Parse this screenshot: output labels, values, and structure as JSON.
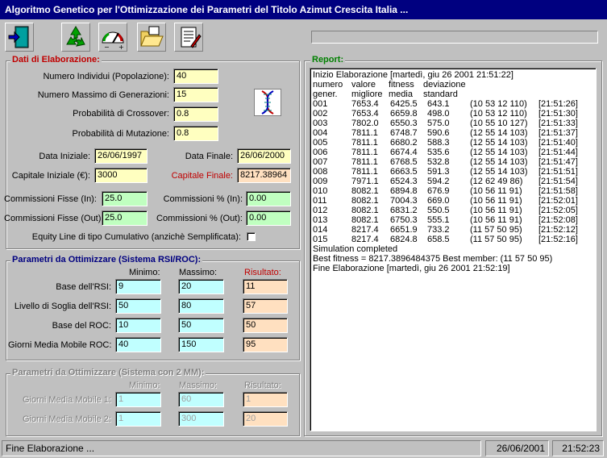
{
  "window": {
    "title": "Algoritmo Genetico per l'Ottimizzazione dei Parametri del Titolo Azimut Crescita Italia ..."
  },
  "toolbar": {
    "icons": [
      "exit-door-icon",
      "recycle-icon",
      "gauge-icon",
      "folder-open-icon",
      "notes-icon"
    ]
  },
  "elaborazione": {
    "title": "Dati di Elaborazione:",
    "individui_label": "Numero Individui (Popolazione):",
    "individui_value": "40",
    "generazioni_label": "Numero Massimo di Generazioni:",
    "generazioni_value": "15",
    "crossover_label": "Probabilità di Crossover:",
    "crossover_value": "0.8",
    "mutazione_label": "Probabilità di Mutazione:",
    "mutazione_value": "0.8",
    "dna_icon": "dna-icon",
    "data_iniziale_label": "Data Iniziale:",
    "data_iniziale_value": "26/06/1997",
    "data_finale_label": "Data Finale:",
    "data_finale_value": "26/06/2000",
    "capitale_iniziale_label": "Capitale Iniziale (€):",
    "capitale_iniziale_value": "3000",
    "capitale_finale_label": "Capitale Finale:",
    "capitale_finale_value": "8217.38964",
    "comm_fisse_in_label": "Commissioni Fisse (In):",
    "comm_fisse_in_value": "25.0",
    "comm_perc_in_label": "Commissioni % (In):",
    "comm_perc_in_value": "0.00",
    "comm_fisse_out_label": "Commissioni Fisse (Out):",
    "comm_fisse_out_value": "25.0",
    "comm_perc_out_label": "Commissioni % (Out):",
    "comm_perc_out_value": "0.00",
    "equity_label": "Equity Line di tipo Cumulativo (anzichè Semplificata):",
    "equity_checked": false
  },
  "rsi": {
    "title": "Parametri da Ottimizzare (Sistema RSI/ROC):",
    "col_min": "Minimo:",
    "col_max": "Massimo:",
    "col_res": "Risultato:",
    "rows": [
      {
        "label": "Base dell'RSI:",
        "min": "9",
        "max": "20",
        "res": "11"
      },
      {
        "label": "Livello di Soglia dell'RSI:",
        "min": "50",
        "max": "80",
        "res": "57"
      },
      {
        "label": "Base del ROC:",
        "min": "10",
        "max": "50",
        "res": "50"
      },
      {
        "label": "Giorni Media Mobile ROC:",
        "min": "40",
        "max": "150",
        "res": "95"
      }
    ]
  },
  "mm": {
    "title": "Parametri da Ottimizzare (Sistema con 2 MM):",
    "col_min": "Minimo:",
    "col_max": "Massimo:",
    "col_res": "Risultato:",
    "rows": [
      {
        "label": "Giorni Media Mobile 1:",
        "min": "1",
        "max": "60",
        "res": "1"
      },
      {
        "label": "Giorni Media Mobile 2:",
        "min": "1",
        "max": "300",
        "res": "20"
      }
    ]
  },
  "report": {
    "title": "Report:",
    "header_line": "Inizio Elaborazione    [martedì, giu 26 2001   21:51:22]",
    "col1a": "numero",
    "col1b": "gener.",
    "col2a": "valore",
    "col2b": "migliore",
    "col3a": "fitness",
    "col3b": "media",
    "col4a": "deviazione",
    "col4b": "standard",
    "rows": [
      {
        "n": "001",
        "best": "7653.4",
        "avg": "6425.5",
        "dev": "643.1",
        "genes": "(10 53 12 110)",
        "time": "[21:51:26]"
      },
      {
        "n": "002",
        "best": "7653.4",
        "avg": "6659.8",
        "dev": "498.0",
        "genes": "(10 53 12 110)",
        "time": "[21:51:30]"
      },
      {
        "n": "003",
        "best": "7802.0",
        "avg": "6550.3",
        "dev": "575.0",
        "genes": "(10 55 10 127)",
        "time": "[21:51:33]"
      },
      {
        "n": "004",
        "best": "7811.1",
        "avg": "6748.7",
        "dev": "590.6",
        "genes": "(12 55 14 103)",
        "time": "[21:51:37]"
      },
      {
        "n": "005",
        "best": "7811.1",
        "avg": "6680.2",
        "dev": "588.3",
        "genes": "(12 55 14 103)",
        "time": "[21:51:40]"
      },
      {
        "n": "006",
        "best": "7811.1",
        "avg": "6674.4",
        "dev": "535.6",
        "genes": "(12 55 14 103)",
        "time": "[21:51:44]"
      },
      {
        "n": "007",
        "best": "7811.1",
        "avg": "6768.5",
        "dev": "532.8",
        "genes": "(12 55 14 103)",
        "time": "[21:51:47]"
      },
      {
        "n": "008",
        "best": "7811.1",
        "avg": "6663.5",
        "dev": "591.3",
        "genes": "(12 55 14 103)",
        "time": "[21:51:51]"
      },
      {
        "n": "009",
        "best": "7971.1",
        "avg": "6524.3",
        "dev": "594.2",
        "genes": "(12 62 49 86)",
        "time": "[21:51:54]"
      },
      {
        "n": "010",
        "best": "8082.1",
        "avg": "6894.8",
        "dev": "676.9",
        "genes": "(10 56 11 91)",
        "time": "[21:51:58]"
      },
      {
        "n": "011",
        "best": "8082.1",
        "avg": "7004.3",
        "dev": "669.0",
        "genes": "(10 56 11 91)",
        "time": "[21:52:01]"
      },
      {
        "n": "012",
        "best": "8082.1",
        "avg": "6831.2",
        "dev": "550.5",
        "genes": "(10 56 11 91)",
        "time": "[21:52:05]"
      },
      {
        "n": "013",
        "best": "8082.1",
        "avg": "6750.3",
        "dev": "555.1",
        "genes": "(10 56 11 91)",
        "time": "[21:52:08]"
      },
      {
        "n": "014",
        "best": "8217.4",
        "avg": "6651.9",
        "dev": "733.2",
        "genes": "(11 57 50 95)",
        "time": "[21:52:12]"
      },
      {
        "n": "015",
        "best": "8217.4",
        "avg": "6824.8",
        "dev": "658.5",
        "genes": "(11 57 50 95)",
        "time": "[21:52:16]"
      }
    ],
    "sim_completed": "Simulation completed",
    "best_line": "Best fitness = 8217.3896484375     Best member:  (11 57 50 95)",
    "end_line": "Fine Elaborazione    [martedì, giu 26 2001   21:52:19]"
  },
  "status": {
    "message": "Fine Elaborazione ...",
    "date": "26/06/2001",
    "time": "21:52:23"
  },
  "colors": {
    "titlebar": "#000080",
    "group_red": "#c00000",
    "group_blue": "#000080",
    "group_green": "#008000"
  }
}
